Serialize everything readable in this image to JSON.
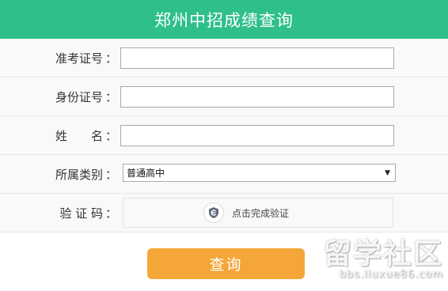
{
  "header": {
    "title": "郑州中招成绩查询"
  },
  "form": {
    "rows": [
      {
        "label": "准考证号",
        "colon": "：",
        "value": ""
      },
      {
        "label": "身份证号",
        "colon": "：",
        "value": ""
      },
      {
        "label": "姓　　名",
        "colon": "：",
        "value": ""
      },
      {
        "label": "所属类别",
        "colon": "：",
        "selected": "普通高中"
      },
      {
        "label": "验 证 码",
        "colon": "：",
        "captcha_text": "点击完成验证"
      }
    ]
  },
  "submit": {
    "label": "查询"
  },
  "watermark": {
    "main": "留学社区",
    "sub": "bbs.liuxue86.com"
  },
  "colors": {
    "header": "#2ebf8b",
    "button": "#f5a638",
    "icon": "captcha-shield-icon"
  }
}
